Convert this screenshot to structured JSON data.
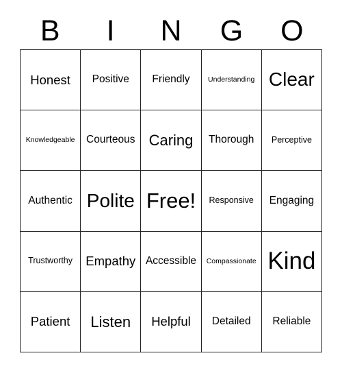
{
  "card": {
    "title": "BINGO",
    "header_letters": [
      "B",
      "I",
      "N",
      "G",
      "O"
    ],
    "grid_size": "5x5",
    "free_space_label": "Free!",
    "border_color": "#222222",
    "background_color": "#ffffff",
    "text_color": "#000000",
    "rows": [
      {
        "cells": [
          {
            "label": "Honest",
            "size": "lg"
          },
          {
            "label": "Positive",
            "size": "md"
          },
          {
            "label": "Friendly",
            "size": "md"
          },
          {
            "label": "Understanding",
            "size": "xs"
          },
          {
            "label": "Clear",
            "size": "xxl"
          }
        ]
      },
      {
        "cells": [
          {
            "label": "Knowledgeable",
            "size": "xs"
          },
          {
            "label": "Courteous",
            "size": "md"
          },
          {
            "label": "Caring",
            "size": "xl"
          },
          {
            "label": "Thorough",
            "size": "md"
          },
          {
            "label": "Perceptive",
            "size": "sm"
          }
        ]
      },
      {
        "cells": [
          {
            "label": "Authentic",
            "size": "md"
          },
          {
            "label": "Polite",
            "size": "xxl"
          },
          {
            "label": "Free!",
            "size": "xxxl"
          },
          {
            "label": "Responsive",
            "size": "sm"
          },
          {
            "label": "Engaging",
            "size": "md"
          }
        ]
      },
      {
        "cells": [
          {
            "label": "Trustworthy",
            "size": "sm"
          },
          {
            "label": "Empathy",
            "size": "lg"
          },
          {
            "label": "Accessible",
            "size": "md"
          },
          {
            "label": "Compassionate",
            "size": "xs"
          },
          {
            "label": "Kind",
            "size": "mega"
          }
        ]
      },
      {
        "cells": [
          {
            "label": "Patient",
            "size": "lg"
          },
          {
            "label": "Listen",
            "size": "xl"
          },
          {
            "label": "Helpful",
            "size": "lg"
          },
          {
            "label": "Detailed",
            "size": "md"
          },
          {
            "label": "Reliable",
            "size": "md"
          }
        ]
      }
    ]
  }
}
